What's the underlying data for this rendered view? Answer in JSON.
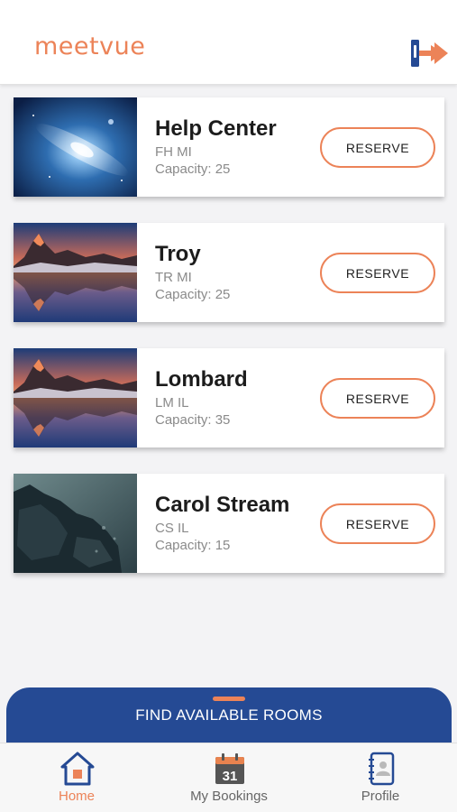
{
  "app": {
    "logo_text": "meetvue",
    "brand_color": "#ec8358",
    "primary_color": "#254a94",
    "logout_icon": "logout-arrow-icon"
  },
  "rooms": [
    {
      "name": "Help Center",
      "code": "FH MI",
      "capacity": "Capacity: 25",
      "reserve_label": "RESERVE",
      "image": "galaxy-image"
    },
    {
      "name": "Troy",
      "code": "TR MI",
      "capacity": "Capacity: 25",
      "reserve_label": "RESERVE",
      "image": "mountain-lake-image"
    },
    {
      "name": "Lombard",
      "code": "LM IL",
      "capacity": "Capacity: 35",
      "reserve_label": "RESERVE",
      "image": "mountain-lake-image"
    },
    {
      "name": "Carol Stream",
      "code": "CS IL",
      "capacity": "Capacity: 15",
      "reserve_label": "RESERVE",
      "image": "rocky-shore-image"
    }
  ],
  "find_rooms": {
    "label": "FIND AVAILABLE ROOMS"
  },
  "tabs": [
    {
      "label": "Home",
      "icon": "home-icon",
      "active": true
    },
    {
      "label": "My Bookings",
      "icon": "calendar-icon",
      "calendar_day": "31",
      "active": false
    },
    {
      "label": "Profile",
      "icon": "contact-book-icon",
      "active": false
    }
  ]
}
